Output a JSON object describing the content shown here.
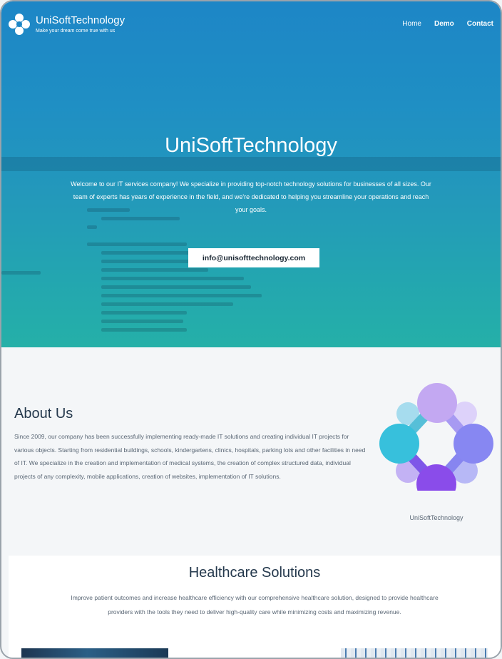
{
  "header": {
    "brand": "UniSoftTechnology",
    "tagline": "Make your dream come true with us",
    "nav": [
      {
        "label": "Home"
      },
      {
        "label": "Demo"
      },
      {
        "label": "Contact"
      }
    ]
  },
  "hero": {
    "title": "UniSoftTechnology",
    "text": "Welcome to our IT services company! We specialize in providing top-notch technology solutions for businesses of all sizes. Our team of experts has years of experience in the field, and we're dedicated to helping you streamline your operations and reach your goals.",
    "email_button": "info@unisofttechnology.com"
  },
  "about": {
    "title": "About Us",
    "text": "Since 2009, our company has been successfully implementing ready-made IT solutions and creating individual IT projects for various objects. Starting from residential buildings, schools, kindergartens, clinics, hospitals, parking lots and other facilities in need of IT.  We specialize in the creation and implementation of medical systems, the creation of complex structured data, individual projects of any complexity, mobile applications, creation of websites, implementation of IT solutions.",
    "logo_caption": "UniSoftTechnology"
  },
  "healthcare": {
    "title": "Healthcare Solutions",
    "text": "Improve patient outcomes and increase healthcare efficiency with our comprehensive healthcare solution, designed to provide healthcare providers with the tools they need to deliver high-quality care while minimizing costs and maximizing revenue."
  },
  "colors": {
    "hero_top": "#1d86c6",
    "hero_bottom": "#25b0a8",
    "heading": "#24384c",
    "body_text": "#5a6775"
  }
}
